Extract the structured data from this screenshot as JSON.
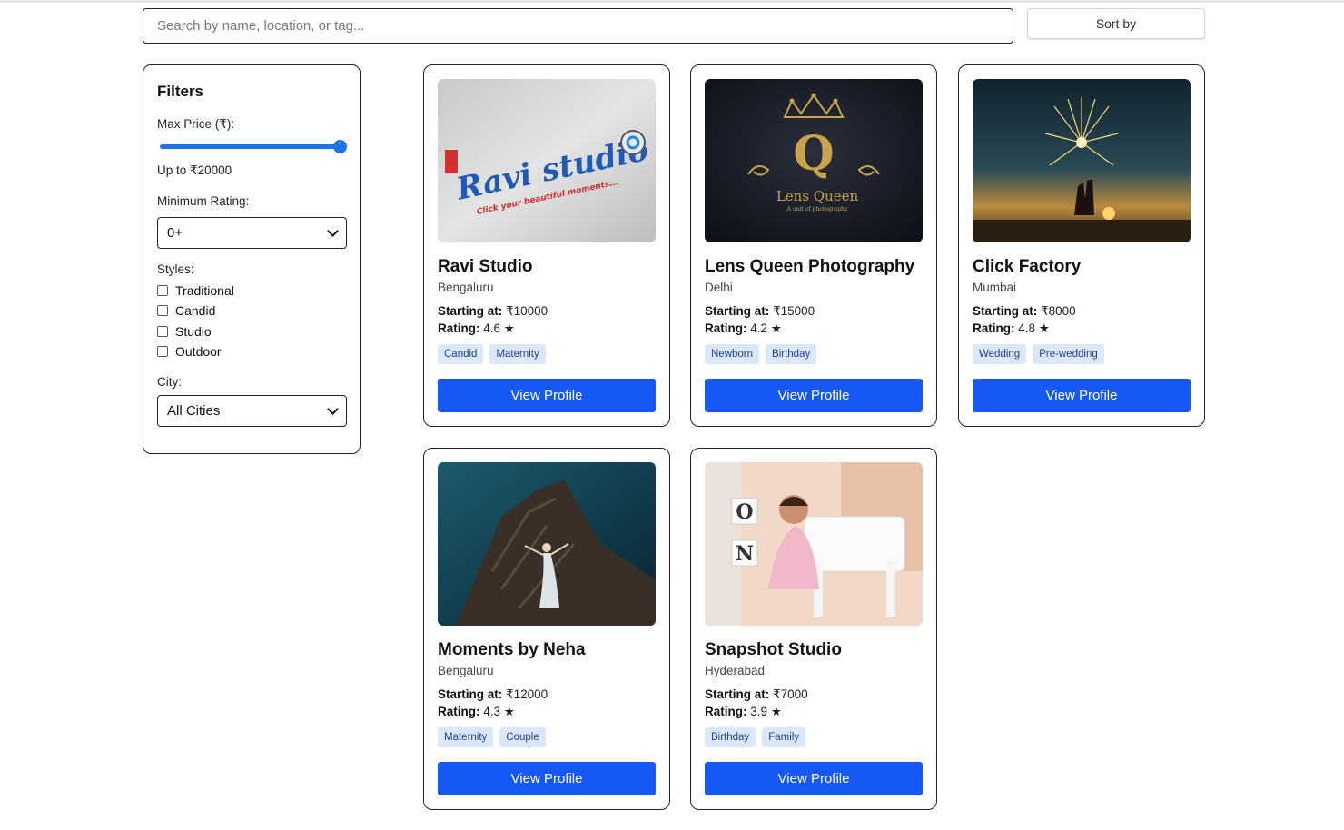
{
  "search": {
    "placeholder": "Search by name, location, or tag..."
  },
  "sort": {
    "label": "Sort by"
  },
  "filters": {
    "title": "Filters",
    "max_price_label": "Max Price (₹):",
    "max_price_value": 20000,
    "max_price_text": "Up to ₹20000",
    "min_rating_label": "Minimum Rating:",
    "min_rating_selected": "0+",
    "styles_label": "Styles:",
    "styles": [
      {
        "label": "Traditional",
        "checked": false
      },
      {
        "label": "Candid",
        "checked": false
      },
      {
        "label": "Studio",
        "checked": false
      },
      {
        "label": "Outdoor",
        "checked": false
      }
    ],
    "city_label": "City:",
    "city_selected": "All Cities"
  },
  "cards": [
    {
      "name": "Ravi Studio",
      "city": "Bengaluru",
      "price_label": "Starting at:",
      "price": "₹10000",
      "rating_label": "Rating:",
      "rating": "4.6 ★",
      "tags": [
        "Candid",
        "Maternity"
      ],
      "button": "View Profile",
      "image": {
        "logo_text": "Ravi studio",
        "tagline": "Click your beautiful moments..."
      }
    },
    {
      "name": "Lens Queen Photography",
      "city": "Delhi",
      "price_label": "Starting at:",
      "price": "₹15000",
      "rating_label": "Rating:",
      "rating": "4.2 ★",
      "tags": [
        "Newborn",
        "Birthday"
      ],
      "button": "View Profile",
      "image": {
        "logo_letter": "Q",
        "logo_text": "Lens Queen",
        "tagline": "A unit of photography"
      }
    },
    {
      "name": "Click Factory",
      "city": "Mumbai",
      "price_label": "Starting at:",
      "price": "₹8000",
      "rating_label": "Rating:",
      "rating": "4.8 ★",
      "tags": [
        "Wedding",
        "Pre-wedding"
      ],
      "button": "View Profile"
    },
    {
      "name": "Moments by Neha",
      "city": "Bengaluru",
      "price_label": "Starting at:",
      "price": "₹12000",
      "rating_label": "Rating:",
      "rating": "4.3 ★",
      "tags": [
        "Maternity",
        "Couple"
      ],
      "button": "View Profile"
    },
    {
      "name": "Snapshot Studio",
      "city": "Hyderabad",
      "price_label": "Starting at:",
      "price": "₹7000",
      "rating_label": "Rating:",
      "rating": "3.9 ★",
      "tags": [
        "Birthday",
        "Family"
      ],
      "button": "View Profile",
      "image": {
        "letters": [
          "O",
          "N"
        ]
      }
    }
  ],
  "colors": {
    "accent": "#1558f5",
    "tag_bg": "#dbe7fb",
    "tag_text": "#1f3f8a",
    "slider": "#1a73e8"
  }
}
